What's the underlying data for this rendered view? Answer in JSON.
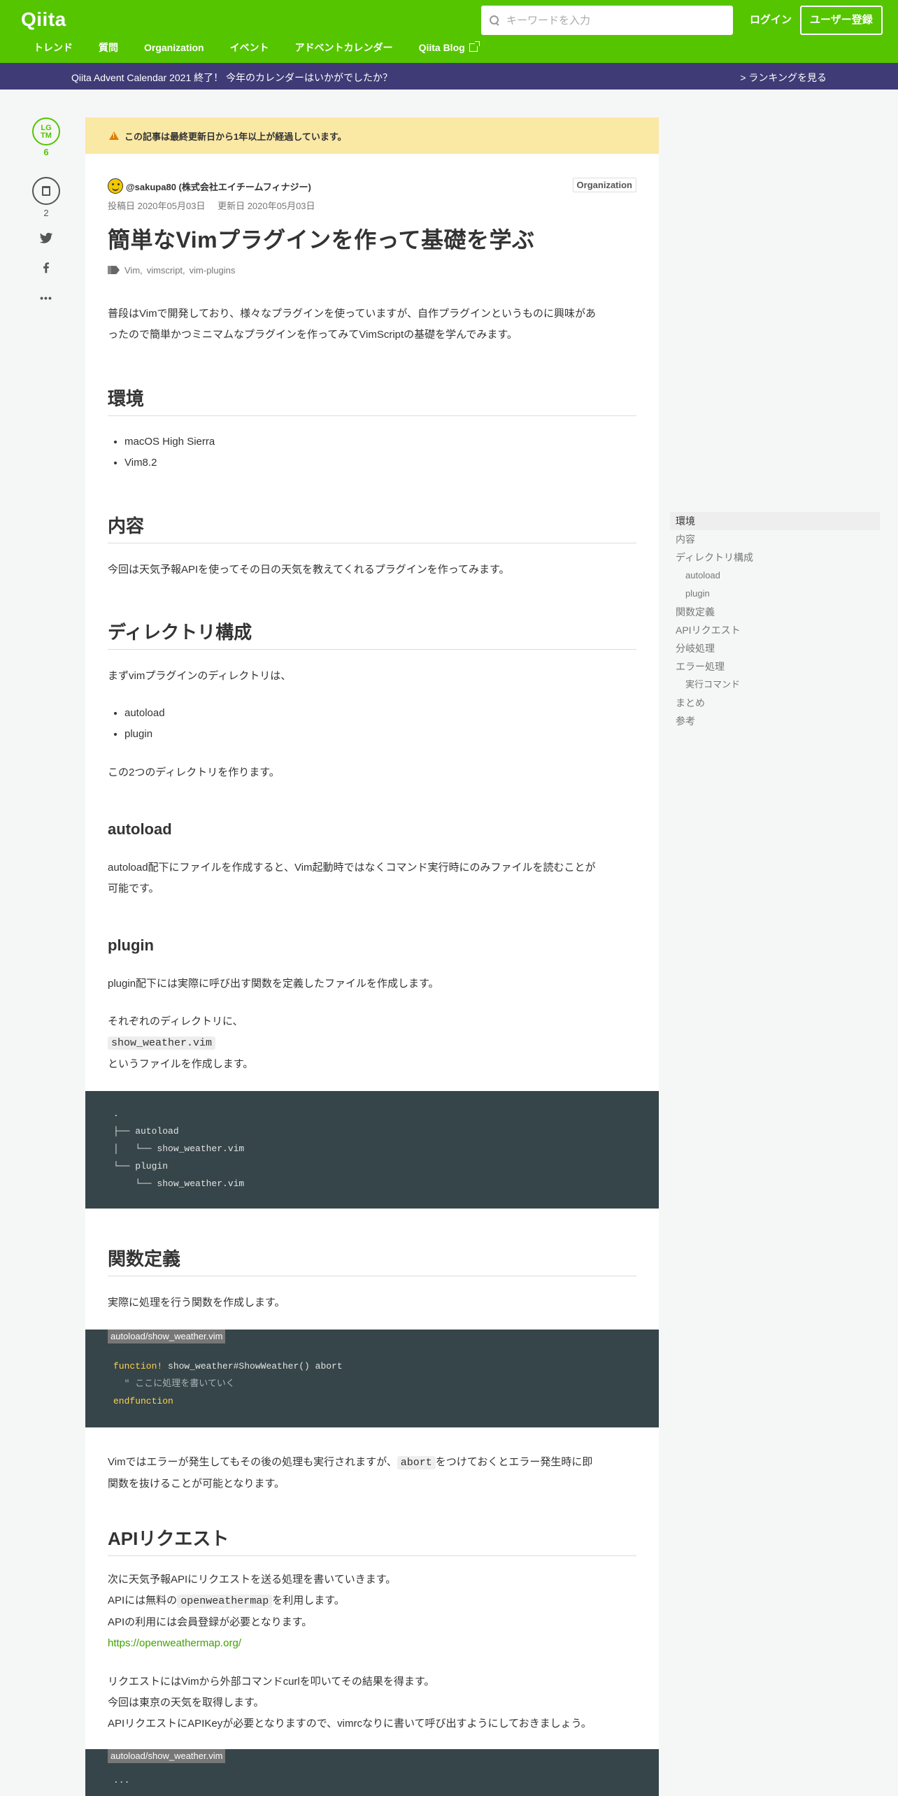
{
  "header": {
    "logo": "Qiita",
    "search_placeholder": "キーワードを入力",
    "login": "ログイン",
    "signup": "ユーザー登録",
    "nav": [
      "トレンド",
      "質問",
      "Organization",
      "イベント",
      "アドベントカレンダー",
      "Qiita Blog"
    ]
  },
  "announce": {
    "message": "Qiita Advent Calendar 2021 終了！ 今年のカレンダーはいかがでしたか？",
    "ranking": "> ランキングを見る"
  },
  "side": {
    "lgtm_label_1": "LG",
    "lgtm_label_2": "TM",
    "lgtm_count": "6",
    "stock_count": "2",
    "more": "•••"
  },
  "article": {
    "warning": "この記事は最終更新日から1年以上が経過しています。",
    "author": "@sakupa80 (株式会社エイチームフィナジー)",
    "org_badge": "Organization",
    "posted": "投稿日 2020年05月03日",
    "updated": "更新日 2020年05月03日",
    "title": "簡単なVimプラグインを作って基礎を学ぶ",
    "tags": [
      "Vim,",
      "vimscript,",
      "vim-plugins"
    ],
    "intro_1": "普段はVimで開発しており、様々なプラグインを使っていますが、自作プラグインというものに興味があ",
    "intro_2": "ったので簡単かつミニマムなプラグインを作ってみてVimScriptの基礎を学んでみます。",
    "env_heading": "環境",
    "env_items": [
      "macOS High Sierra",
      "Vim8.2"
    ],
    "content_heading": "内容",
    "content_text": "今回は天気予報APIを使ってその日の天気を教えてくれるプラグインを作ってみます。",
    "dir_heading": "ディレクトリ構成",
    "dir_intro": "まずvimプラグインのディレクトリは、",
    "dir_items": [
      "autoload",
      "plugin"
    ],
    "dir_after": "この2つのディレクトリを作ります。",
    "autoload_heading": "autoload",
    "autoload_text_1": "autoload配下にファイルを作成すると、Vim起動時ではなくコマンド実行時にのみファイルを読むことが",
    "autoload_text_2": "可能です。",
    "plugin_heading": "plugin",
    "plugin_text": "plugin配下には実際に呼び出す関数を定義したファイルを作成します。",
    "each_dir": "それぞれのディレクトリに、",
    "file_code": "show_weather.vim",
    "create_file": "というファイルを作成します。",
    "tree_lines": [
      ".",
      "├── autoload",
      "│   └── show_weather.vim",
      "└── plugin",
      "    └── show_weather.vim"
    ],
    "func_heading": "関数定義",
    "func_text": "実際に処理を行う関数を作成します。",
    "code2_filename": "autoload/show_weather.vim",
    "code2_kw1": "function!",
    "code2_line1_rest": " show_weather#ShowWeather() abort",
    "code2_comment": "  \" ここに処理を書いていく",
    "code2_kw2": "endfunction",
    "abort_text_1a": "Vimではエラーが発生してもその後の処理も実行されますが、",
    "abort_code": "abort",
    "abort_text_1b": "をつけておくとエラー発生時に即",
    "abort_text_2": "関数を抜けることが可能となります。",
    "api_heading": "APIリクエスト",
    "api_line1": "次に天気予報APIにリクエストを送る処理を書いていきます。",
    "api_line2a": "APIには無料の",
    "api_code": "openweathermap",
    "api_line2b": "を利用します。",
    "api_line3": "APIの利用には会員登録が必要となります。",
    "api_link": "https://openweathermap.org/",
    "req_line1": "リクエストにはVimから外部コマンドcurlを叩いてその結果を得ます。",
    "req_line2": "今回は東京の天気を取得します。",
    "req_line3": "APIリクエストにAPIKeyが必要となりますので、vimrcなりに書いて呼び出すようにしておきましょう。",
    "code3_filename": "autoload/show_weather.vim",
    "code3_line1": "..."
  },
  "toc": [
    {
      "label": "環境",
      "level": 1,
      "active": true
    },
    {
      "label": "内容",
      "level": 1,
      "active": false
    },
    {
      "label": "ディレクトリ構成",
      "level": 1,
      "active": false
    },
    {
      "label": "autoload",
      "level": 2,
      "active": false
    },
    {
      "label": "plugin",
      "level": 2,
      "active": false
    },
    {
      "label": "関数定義",
      "level": 1,
      "active": false
    },
    {
      "label": "APIリクエスト",
      "level": 1,
      "active": false
    },
    {
      "label": "分岐処理",
      "level": 1,
      "active": false
    },
    {
      "label": "エラー処理",
      "level": 1,
      "active": false
    },
    {
      "label": "実行コマンド",
      "level": 2,
      "active": false
    },
    {
      "label": "まとめ",
      "level": 1,
      "active": false
    },
    {
      "label": "参考",
      "level": 1,
      "active": false
    }
  ],
  "colors": {
    "brand": "#55c500",
    "announce_bg": "#3f3b76",
    "warning_bg": "#fae8a5",
    "code_bg": "#364549"
  }
}
